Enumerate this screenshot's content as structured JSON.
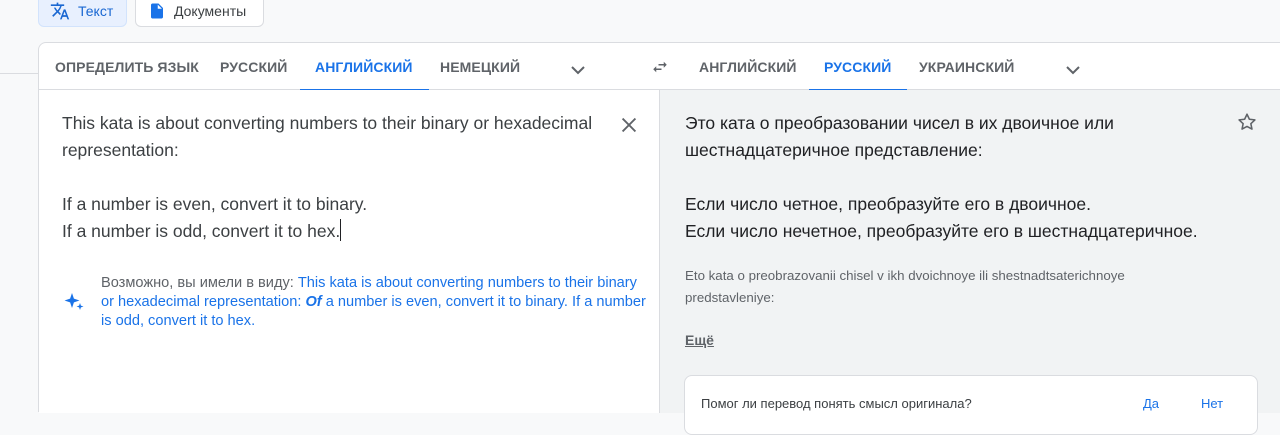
{
  "modes": {
    "text_label": "Текст",
    "docs_label": "Документы"
  },
  "source": {
    "tabs": [
      {
        "label": "ОПРЕДЕЛИТЬ ЯЗЫК"
      },
      {
        "label": "РУССКИЙ"
      },
      {
        "label": "АНГЛИЙСКИЙ"
      },
      {
        "label": "НЕМЕЦКИЙ"
      }
    ],
    "active_tab": "АНГЛИЙСКИЙ",
    "text": "This kata is about converting numbers to their binary or hexadecimal representation:\n\nIf a number is even, convert it to binary.\nIf a number is odd, convert it to hex.",
    "suggestion": {
      "prefix": "Возможно, вы имели в виду: ",
      "part1": "This kata is about converting numbers to their binary or hexadecimal representation: ",
      "bold": "Of",
      "part2": " a number is even, convert it to binary. If a number is odd, convert it to hex."
    }
  },
  "target": {
    "tabs": [
      {
        "label": "АНГЛИЙСКИЙ"
      },
      {
        "label": "РУССКИЙ"
      },
      {
        "label": "УКРАИНСКИЙ"
      }
    ],
    "active_tab": "РУССКИЙ",
    "text": "Это ката о преобразовании чисел в их двоичное или шестнадцатеричное представление:\n\nЕсли число четное, преобразуйте его в двоичное.\nЕсли число нечетное, преобразуйте его в шестнадцатеричное.",
    "transliteration": "Eto kata o preobrazovanii chisel v ikh dvoichnoye ili shestnadtsaterichnoye predstavleniye:",
    "more_label": "Ещё",
    "feedback": {
      "question": "Помог ли перевод понять смысл оригинала?",
      "yes": "Да",
      "no": "Нет"
    }
  },
  "colors": {
    "accent": "#1a73e8",
    "target_bg": "#f1f3f4",
    "chip_bg": "#e8f0fe"
  },
  "icons": [
    "translate-icon",
    "document-icon",
    "chevron-down-icon",
    "swap-icon",
    "close-icon",
    "sparkle-icon",
    "star-icon"
  ]
}
